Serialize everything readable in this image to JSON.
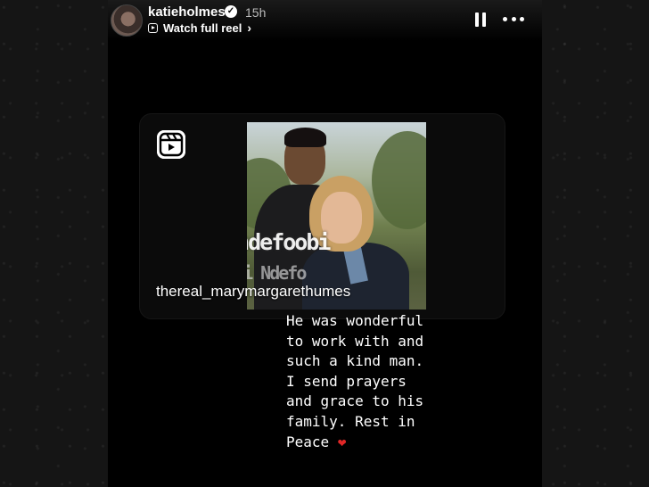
{
  "story": {
    "username": "katieholmes",
    "time_ago": "15h",
    "reel_link_label": "Watch full reel",
    "reel_link_chevron": "›",
    "verified_icon": "checkmark-badge-icon",
    "verified_mark": "✓"
  },
  "reel": {
    "author": "thereal_marymargarethumes",
    "watermark_handle": "@ndefoobi",
    "watermark_name": "Obi Ndefo",
    "icon": "reel-icon"
  },
  "caption": {
    "text": "He was wonderful\nto work with and\nsuch a kind man.\nI send prayers\nand grace to his\nfamily. Rest in\nPeace ",
    "emoji": "❤"
  },
  "colors": {
    "heart": "#e02727",
    "story_background": "#000000"
  }
}
